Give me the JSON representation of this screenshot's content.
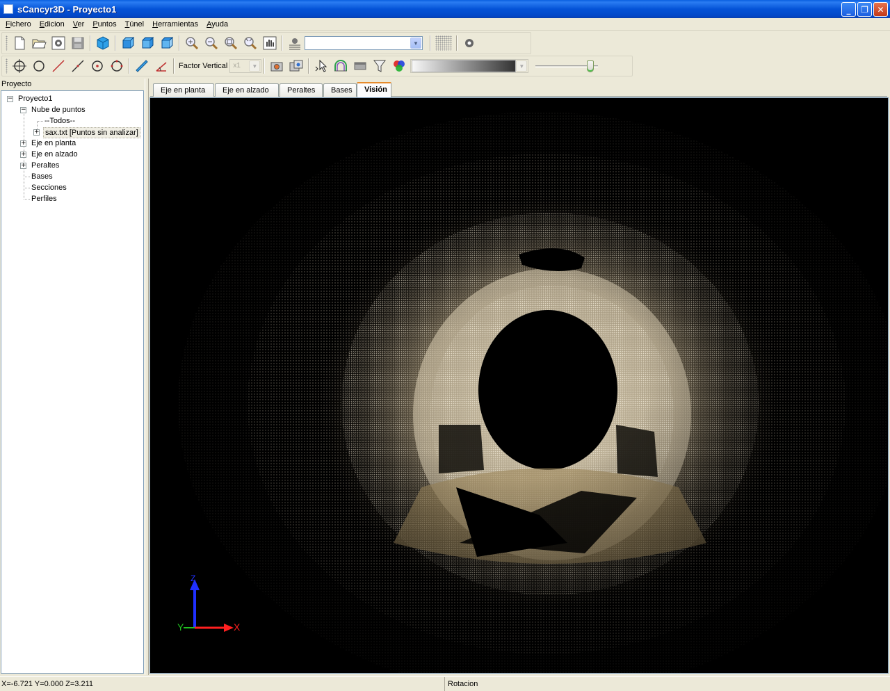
{
  "window": {
    "title": "sCancyr3D - Proyecto1"
  },
  "menu": {
    "items": [
      {
        "u": "F",
        "rest": "ichero"
      },
      {
        "u": "E",
        "rest": "dicion"
      },
      {
        "u": "V",
        "rest": "er"
      },
      {
        "u": "P",
        "rest": "untos"
      },
      {
        "u": "T",
        "rest": "únel"
      },
      {
        "u": "H",
        "rest": "erramientas"
      },
      {
        "u": "A",
        "rest": "yuda"
      }
    ]
  },
  "toolbar2": {
    "factor_vertical_label": "Factor Vertical",
    "factor_vertical_value": "x1"
  },
  "project_panel": {
    "header": "Proyecto",
    "tree": {
      "root": "Proyecto1",
      "point_cloud": "Nube de puntos",
      "all": "--Todos--",
      "file": "sax.txt [Puntos sin analizar]",
      "eje_planta": "Eje en planta",
      "eje_alzado": "Eje en alzado",
      "peraltes": "Peraltes",
      "bases": "Bases",
      "secciones": "Secciones",
      "perfiles": "Perfiles"
    }
  },
  "tabs": [
    "Eje en planta",
    "Eje en alzado",
    "Peraltes",
    "Bases",
    "Visión"
  ],
  "active_tab": "Visión",
  "viewport": {
    "axis_labels": {
      "x": "X",
      "y": "Y",
      "z": "Z"
    },
    "colors": {
      "x": "#ff2020",
      "y": "#20c020",
      "z": "#2030ff"
    }
  },
  "status": {
    "coordinates": "X=-6.721 Y=0.000 Z=3.211",
    "mode": "Rotacion"
  }
}
